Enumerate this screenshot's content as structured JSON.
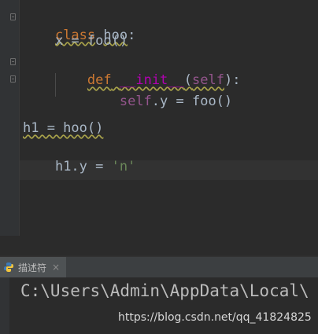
{
  "editor": {
    "lines": [
      {
        "kw": "class",
        "rest": " ",
        "name": "hoo",
        "end": ":"
      },
      {
        "text": "    x = foo()"
      },
      {
        "indent": "    ",
        "kw": "def",
        "space": " ",
        "dunder": "__init__",
        "open": "(",
        "self": "self",
        "close": "):"
      },
      {
        "indent": "        ",
        "self": "self",
        "rest": ".y = foo()"
      },
      {
        "text": ""
      },
      {
        "text": "h1 = hoo()"
      },
      {
        "prefix": "h1.y = ",
        "str": "'n'"
      }
    ]
  },
  "tool_window": {
    "tab_label": "描述符",
    "tab_close": "×",
    "console_output": "C:\\Users\\Admin\\AppData\\Local\\",
    "watermark": "https://blog.csdn.net/qq_41824825"
  },
  "icons": {
    "tab_icon": "python-icon",
    "fold_markers": [
      "fold-start-icon",
      "fold-end-icon"
    ]
  }
}
